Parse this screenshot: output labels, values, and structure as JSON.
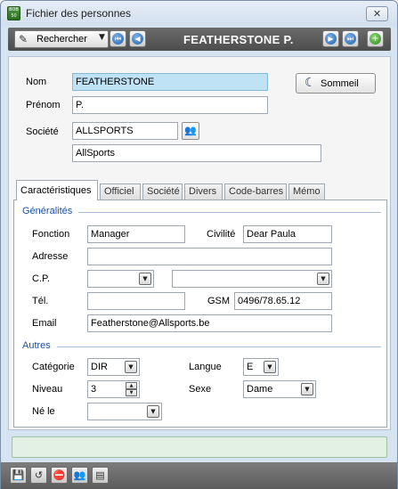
{
  "window": {
    "title": "Fichier des personnes",
    "app_icon_text": "BOB 50",
    "close_label": "✕"
  },
  "toolbar": {
    "search_label": "Rechercher",
    "record_title": "FEATHERSTONE P."
  },
  "form": {
    "nom_label": "Nom",
    "nom_value": "FEATHERSTONE",
    "prenom_label": "Prénom",
    "prenom_value": "P.",
    "societe_label": "Société",
    "societe_code": "ALLSPORTS",
    "societe_name": "AllSports",
    "sleep_label": "Sommeil"
  },
  "tabs": [
    {
      "label": "Caractéristiques"
    },
    {
      "label": "Officiel"
    },
    {
      "label": "Société"
    },
    {
      "label": "Divers"
    },
    {
      "label": "Code-barres"
    },
    {
      "label": "Mémo"
    }
  ],
  "general": {
    "section_title": "Généralités",
    "fonction_label": "Fonction",
    "fonction_value": "Manager",
    "civilite_label": "Civilité",
    "civilite_value": "Dear Paula",
    "adresse_label": "Adresse",
    "adresse_value": "",
    "cp_label": "C.P.",
    "cp_value": "",
    "localite_value": "",
    "tel_label": "Tél.",
    "tel_value": "",
    "gsm_label": "GSM",
    "gsm_value": "0496/78.65.12",
    "email_label": "Email",
    "email_value": "Featherstone@Allsports.be"
  },
  "others": {
    "section_title": "Autres",
    "categorie_label": "Catégorie",
    "categorie_value": "DIR",
    "langue_label": "Langue",
    "langue_value": "E",
    "niveau_label": "Niveau",
    "niveau_value": "3",
    "sexe_label": "Sexe",
    "sexe_value": "Dame",
    "ne_le_label": "Né le",
    "ne_le_value": ""
  },
  "status_text": "",
  "icons": {
    "search": "edit-search-icon",
    "prev_first": "first-record-icon",
    "prev": "previous-record-icon",
    "next": "next-record-icon",
    "last": "last-record-icon",
    "add": "add-record-icon"
  }
}
